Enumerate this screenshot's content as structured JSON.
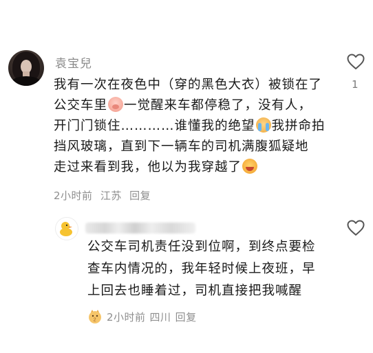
{
  "comment": {
    "username": "袁宝兒",
    "text_lines": [
      [
        "我有一次在夜色中（穿的黑色大衣）被锁在了"
      ],
      [
        "公交车里",
        "pig-face-emoji",
        "一觉醒来车都停稳了，没有人，"
      ],
      [
        "开门门锁住…………谁懂我的绝望",
        "crying-emoji",
        "我拼命拍"
      ],
      [
        "挡风玻璃，直到下一辆车的司机满腹狐疑地"
      ],
      [
        "走过来看到我，他以为我穿越了",
        "laughing-emoji"
      ]
    ],
    "line1": "我有一次在夜色中（穿的黑色大衣）被锁在了",
    "line2a": "公交车里",
    "line2b": "一觉醒来车都停稳了，没有人，",
    "line3a": "开门门锁住…………谁懂我的绝望",
    "line3b": "我拼命拍",
    "line4": "挡风玻璃，直到下一辆车的司机满腹狐疑地",
    "line5a": "走过来看到我，他以为我穿越了",
    "time": "2小时前",
    "location": "江苏",
    "reply_label": "回复",
    "like_count": "1"
  },
  "reply": {
    "username": "",
    "line1": "公交车司机责任没到位啊，到终点要检",
    "line2": "查车内情况的，我年轻时候上夜班，早",
    "line3": "上回去也睡着过，司机直接把我喊醒",
    "badge_level": "2",
    "time": "2小时前",
    "location": "四川",
    "reply_label": "回复"
  },
  "icons": {
    "like": "heart-outline-icon",
    "reply_avatar": "duck-avatar-icon",
    "level_badge": "level-badge-icon"
  },
  "colors": {
    "text": "#1a1a1a",
    "meta": "#8e8e8e",
    "username": "#8a8a8a"
  }
}
